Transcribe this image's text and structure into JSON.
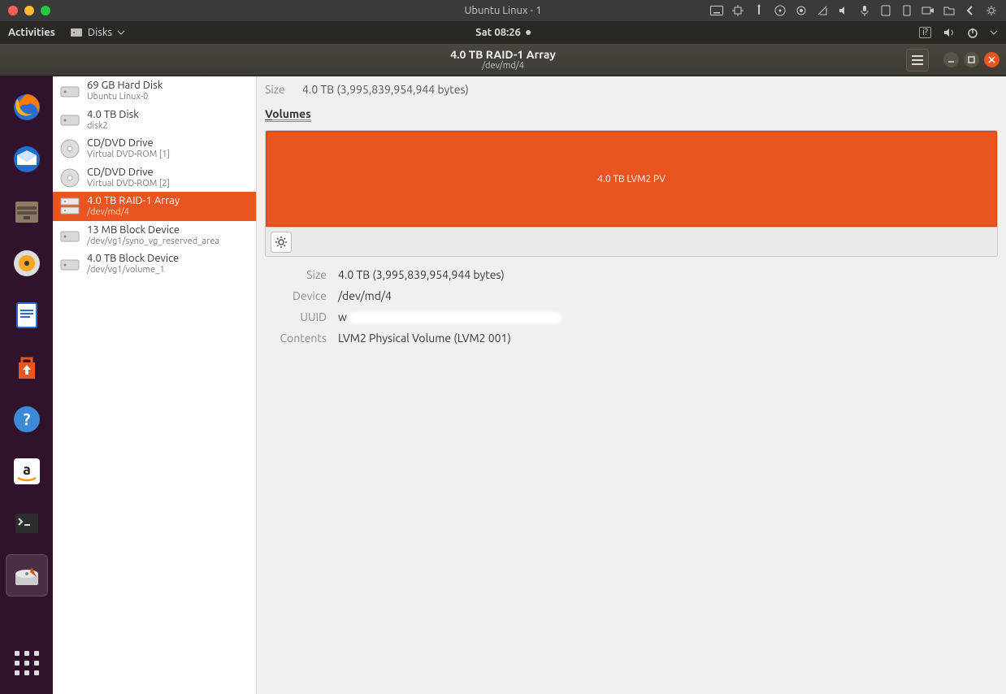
{
  "mac_title": "Ubuntu Linux - 1",
  "gnome": {
    "activities": "Activities",
    "app_name": "Disks",
    "clock": "Sat 08:26"
  },
  "header": {
    "title": "4.0 TB RAID-1 Array",
    "subtitle": "/dev/md/4"
  },
  "top_size": {
    "label": "Size",
    "value": "4.0 TB (3,995,839,954,944 bytes)"
  },
  "volumes_title": "Volumes",
  "partition_label": "4.0 TB LVM2 PV",
  "devices": [
    {
      "title": "69 GB Hard Disk",
      "sub": "Ubuntu Linux-0",
      "icon": "hdd"
    },
    {
      "title": "4.0 TB Disk",
      "sub": "disk2",
      "icon": "hdd"
    },
    {
      "title": "CD/DVD Drive",
      "sub": "Virtual DVD-ROM [1]",
      "icon": "optical"
    },
    {
      "title": "CD/DVD Drive",
      "sub": "Virtual DVD-ROM [2]",
      "icon": "optical"
    },
    {
      "title": "4.0 TB RAID-1 Array",
      "sub": "/dev/md/4",
      "icon": "raid",
      "selected": true
    },
    {
      "title": "13 MB Block Device",
      "sub": "/dev/vg1/syno_vg_reserved_area",
      "icon": "hdd"
    },
    {
      "title": "4.0 TB Block Device",
      "sub": "/dev/vg1/volume_1",
      "icon": "hdd"
    }
  ],
  "properties": {
    "size": {
      "label": "Size",
      "value": "4.0 TB (3,995,839,954,944 bytes)"
    },
    "device": {
      "label": "Device",
      "value": "/dev/md/4"
    },
    "uuid": {
      "label": "UUID",
      "value": "w"
    },
    "contents": {
      "label": "Contents",
      "value": "LVM2 Physical Volume (LVM2 001)"
    }
  },
  "dock_items": [
    "firefox",
    "thunderbird",
    "files",
    "rhythmbox",
    "writer",
    "software",
    "help",
    "amazon",
    "terminal",
    "disks"
  ],
  "colors": {
    "accent": "#e95420"
  }
}
